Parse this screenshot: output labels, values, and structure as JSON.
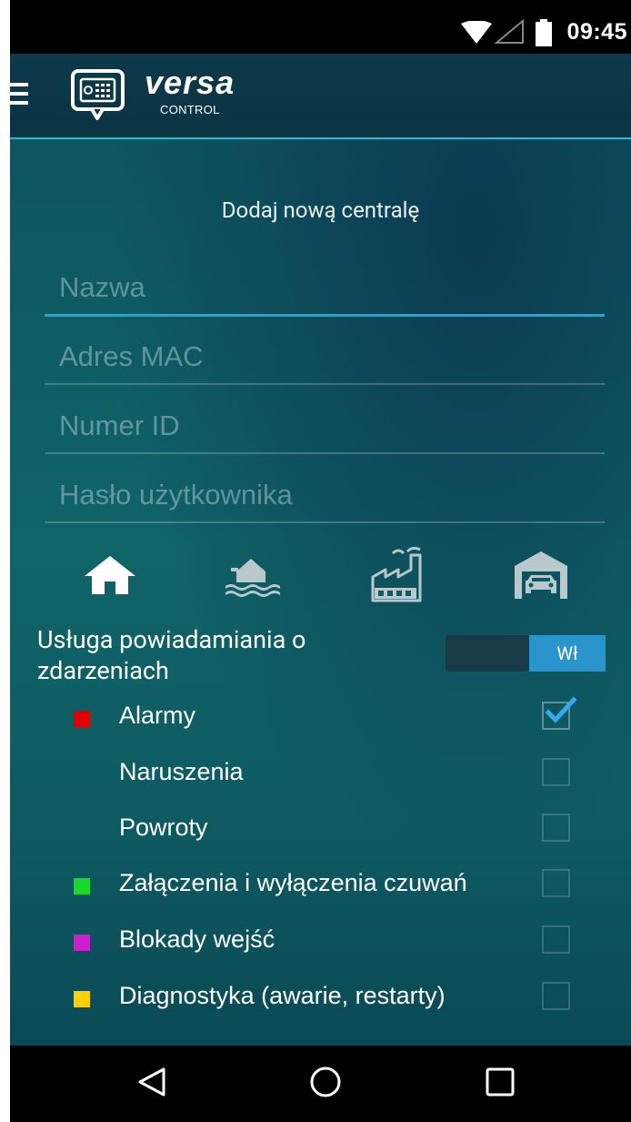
{
  "status_bar": {
    "time": "09:45",
    "icons": [
      "wifi-icon",
      "cellular-signal-icon",
      "battery-icon"
    ]
  },
  "app_bar": {
    "menu_icon": "hamburger-menu-icon",
    "logo_icon": "keypad-icon",
    "brand_name": "versa",
    "brand_sub": "CONTROL",
    "accent_color": "#1bc0da"
  },
  "form": {
    "title": "Dodaj nową centralę",
    "fields": {
      "name": {
        "placeholder": "Nazwa",
        "value": ""
      },
      "mac": {
        "placeholder": "Adres MAC",
        "value": ""
      },
      "id": {
        "placeholder": "Numer ID",
        "value": ""
      },
      "password": {
        "placeholder": "Hasło użytkownika",
        "value": ""
      }
    },
    "focus_color": "#22a6d8",
    "object_types": [
      {
        "name": "house-icon",
        "selected": true
      },
      {
        "name": "flooded-house-icon",
        "selected": false
      },
      {
        "name": "factory-icon",
        "selected": false
      },
      {
        "name": "garage-icon",
        "selected": false
      }
    ]
  },
  "notifications": {
    "label": "Usługa powiadamiania o zdarzeniach",
    "toggle_label": "Wł",
    "toggle_on": true,
    "toggle_color": "#2a95cc",
    "events": [
      {
        "label": "Alarmy",
        "color": "#e00000",
        "checked": true
      },
      {
        "label": "Naruszenia",
        "color": "",
        "checked": false
      },
      {
        "label": "Powroty",
        "color": "",
        "checked": false
      },
      {
        "label": "Załączenia i wyłączenia czuwań",
        "color": "#16d92a",
        "checked": false
      },
      {
        "label": "Blokady wejść",
        "color": "#cc1fd0",
        "checked": false
      },
      {
        "label": "Diagnostyka (awarie, restarty)",
        "color": "#ffd000",
        "checked": false
      }
    ]
  },
  "nav_bar": {
    "icons": [
      "back-icon",
      "home-icon",
      "recents-icon"
    ]
  }
}
